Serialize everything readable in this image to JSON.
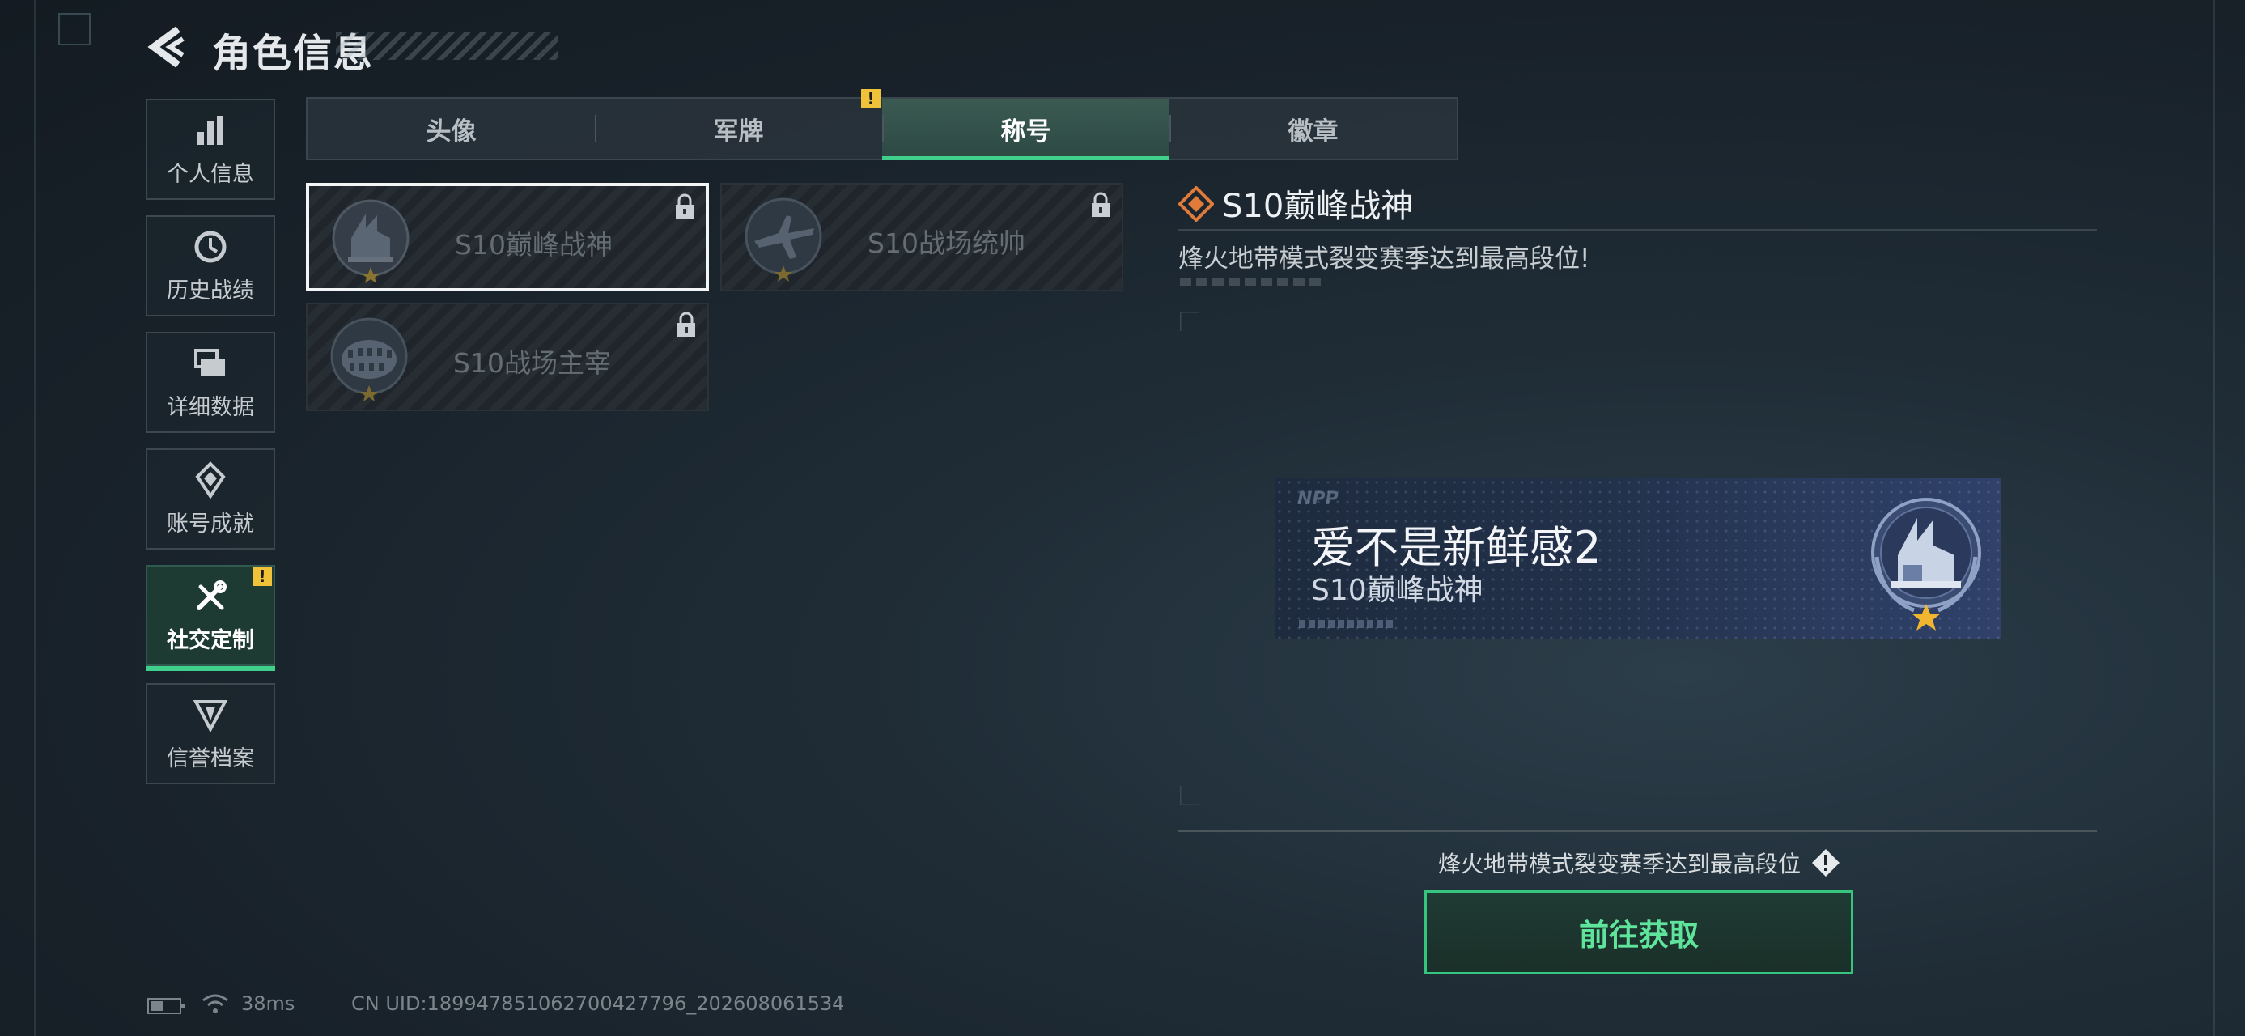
{
  "header": {
    "title": "角色信息"
  },
  "sidebar": {
    "items": [
      {
        "label": "个人信息",
        "icon": "bar-chart-icon"
      },
      {
        "label": "历史战绩",
        "icon": "history-icon"
      },
      {
        "label": "详细数据",
        "icon": "folder-icon"
      },
      {
        "label": "账号成就",
        "icon": "achievement-icon"
      },
      {
        "label": "社交定制",
        "icon": "tools-icon",
        "active": true,
        "badge": "!"
      },
      {
        "label": "信誉档案",
        "icon": "credit-icon"
      }
    ]
  },
  "tabs": [
    {
      "label": "头像"
    },
    {
      "label": "军牌",
      "badge": "!"
    },
    {
      "label": "称号",
      "active": true
    },
    {
      "label": "徽章"
    }
  ],
  "titles": [
    {
      "name": "S10巅峰战神",
      "locked": true,
      "selected": true
    },
    {
      "name": "S10战场统帅",
      "locked": true
    },
    {
      "name": "S10战场主宰",
      "locked": true
    }
  ],
  "detail": {
    "title": "S10巅峰战神",
    "description": "烽火地带模式裂变赛季达到最高段位!"
  },
  "banner": {
    "logo_text": "NPP",
    "player_name": "爱不是新鲜感2",
    "title": "S10巅峰战神"
  },
  "requirement": "烽火地带模式裂变赛季达到最高段位",
  "go_button": "前往获取",
  "status": {
    "ping": "38ms",
    "uid": "CN UID:18994785106270042779​6_202608061534"
  },
  "colors": {
    "accent": "#3fd18c",
    "badge": "#f0c23a",
    "background": "#182129"
  }
}
